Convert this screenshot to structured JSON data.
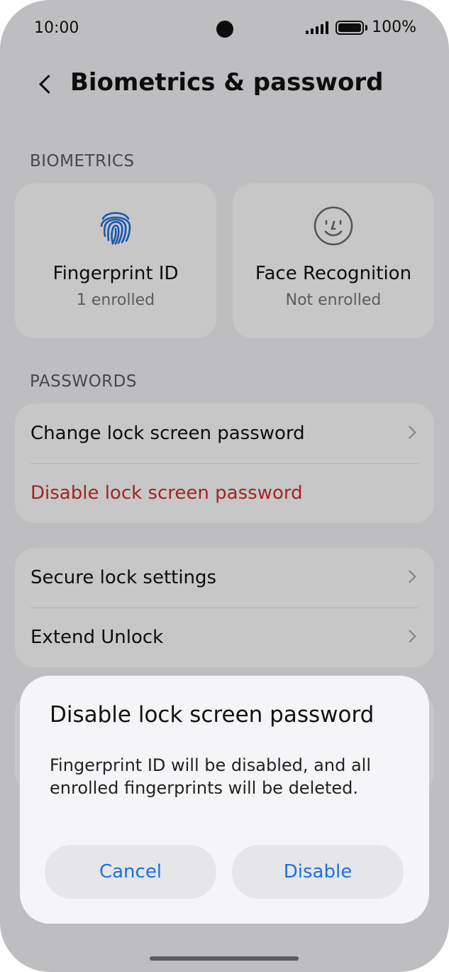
{
  "status_bar": {
    "time": "10:00",
    "battery": "100%"
  },
  "header": {
    "title": "Biometrics & password"
  },
  "biometrics": {
    "section_label": "BIOMETRICS",
    "cards": [
      {
        "title": "Fingerprint ID",
        "status": "1 enrolled",
        "icon": "fingerprint-icon"
      },
      {
        "title": "Face Recognition",
        "status": "Not enrolled",
        "icon": "face-icon"
      }
    ]
  },
  "passwords": {
    "section_label": "PASSWORDS",
    "items": [
      {
        "label": "Change lock screen password"
      },
      {
        "label": "Disable lock screen password"
      }
    ]
  },
  "secure": {
    "items": [
      {
        "label": "Secure lock settings"
      },
      {
        "label": "Extend Unlock"
      }
    ]
  },
  "dialog": {
    "title": "Disable lock screen password",
    "message": "Fingerprint ID will be disabled, and all enrolled fingerprints will be deleted.",
    "cancel_label": "Cancel",
    "confirm_label": "Disable"
  },
  "colors": {
    "accent": "#1f6fe0",
    "danger": "#d32f2f"
  }
}
